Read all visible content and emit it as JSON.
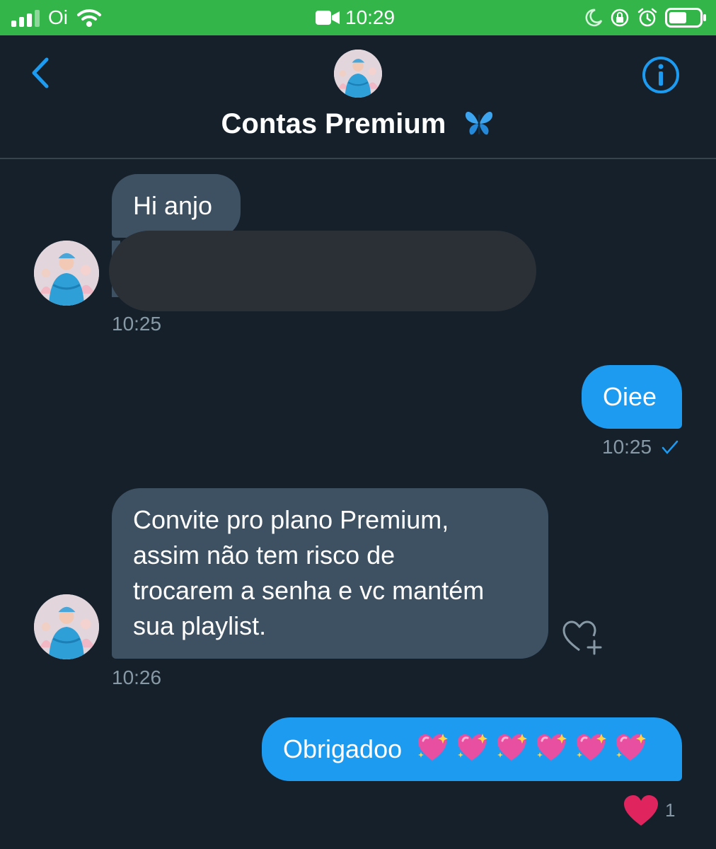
{
  "status_bar": {
    "carrier": "Oi",
    "time": "10:29"
  },
  "header": {
    "title": "Contas Premium",
    "title_emoji": "butterfly",
    "back_icon": "chevron-left-icon",
    "info_icon": "info-icon"
  },
  "messages": [
    {
      "direction": "in",
      "text": "Hi anjo"
    },
    {
      "direction": "in",
      "text": "",
      "redacted": true,
      "time": "10:25"
    },
    {
      "direction": "out",
      "text": "Oiee",
      "time": "10:25"
    },
    {
      "direction": "in",
      "lines": [
        "Convite pro plano Premium,",
        "assim não tem risco de",
        "trocarem a senha e vc mantém",
        "sua playlist."
      ],
      "time": "10:26"
    },
    {
      "direction": "out",
      "text": "Obrigadoo",
      "emoji": "sparkling-heart x6",
      "reaction_count": "1"
    }
  ],
  "colors": {
    "status_bar": "#33b54a",
    "background": "#15202b",
    "incoming_bubble": "#3e5163",
    "outgoing_bubble": "#1d9bf0",
    "accent": "#1d9bf0"
  }
}
